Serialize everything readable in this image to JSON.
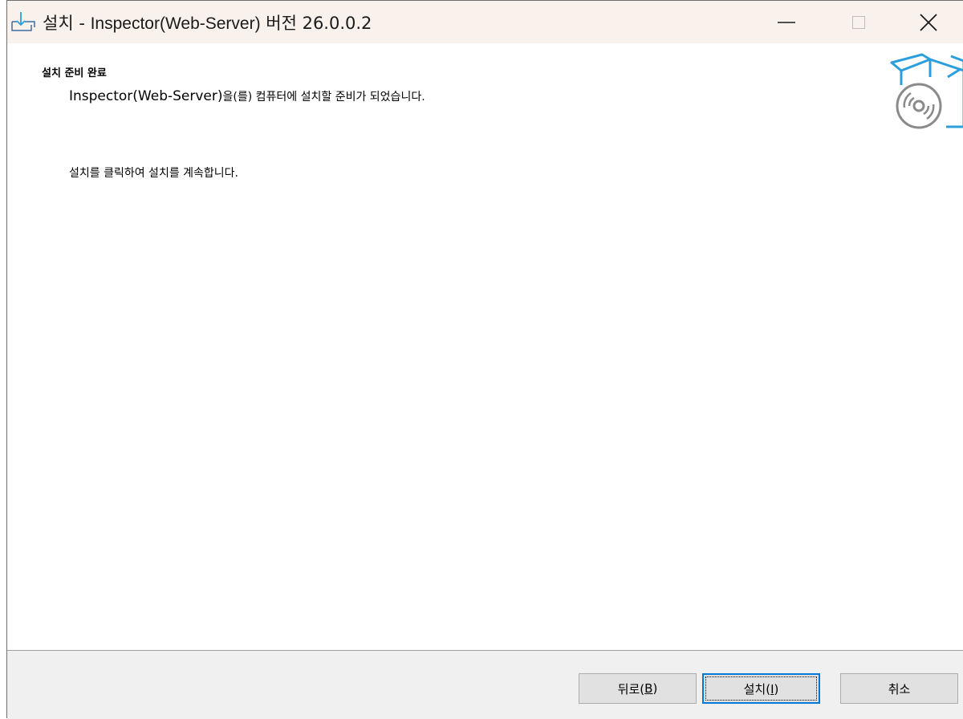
{
  "window": {
    "title_prefix": "설치 - ",
    "title_app": "Inspector(Web-Server)",
    "title_suffix": " 버전 26.0.0.2"
  },
  "header": {
    "heading": "설치 준비 완료",
    "sub_app": "Inspector(Web-Server)",
    "sub_rest_small": "을(를) 컴퓨터에 설치할 준비가 되었습니다."
  },
  "body": {
    "instruction": "설치를 클릭하여 설치를 계속합니다."
  },
  "buttons": {
    "back_prefix": "뒤로(",
    "back_mnemonic": "B",
    "back_suffix": ")",
    "install_prefix": "설치(",
    "install_mnemonic": "I",
    "install_suffix": ")",
    "cancel": "취소"
  },
  "icons": {
    "app": "installer-download-icon",
    "minimize": "minimize-icon",
    "maximize": "maximize-icon",
    "close": "close-icon",
    "header_graphic": "box-cd-icon"
  },
  "colors": {
    "titlebar": "#f9f1ec",
    "accent": "#0078d7",
    "box_blue": "#2b9fdc",
    "footer": "#f0f0f0"
  }
}
